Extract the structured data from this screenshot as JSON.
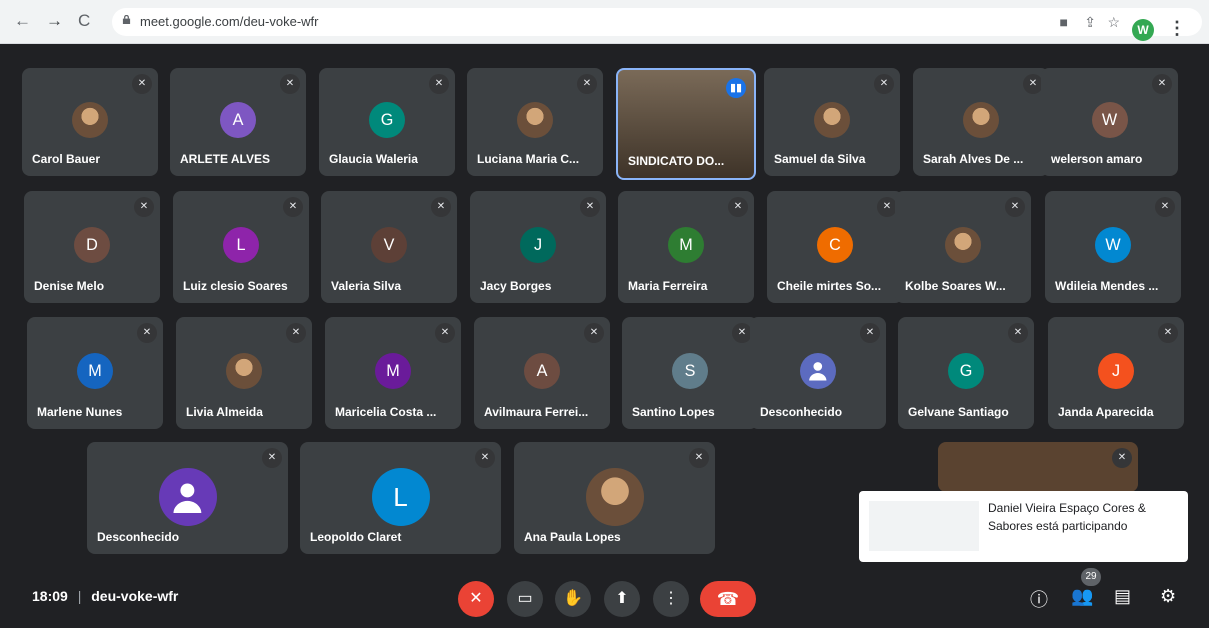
{
  "browser": {
    "url": "meet.google.com/deu-voke-wfr",
    "profile": "W"
  },
  "tiles": [
    {
      "name": "Carol Bauer",
      "initial": "",
      "color": "#3c4043",
      "photo": true
    },
    {
      "name": "ARLETE ALVES",
      "initial": "A",
      "color": "#7e57c2"
    },
    {
      "name": "Glaucia Waleria",
      "initial": "G",
      "color": "#00897b"
    },
    {
      "name": "Luciana Maria C...",
      "initial": "",
      "color": "#3c4043",
      "photo": true
    },
    {
      "name": "SINDICATO DO...",
      "initial": "",
      "color": "#3c4043",
      "video": true
    },
    {
      "name": "Samuel da Silva",
      "initial": "",
      "color": "#3c4043",
      "photo": true
    },
    {
      "name": "Sarah Alves De ...",
      "initial": "",
      "color": "#3c4043",
      "photo": true
    },
    {
      "name": "welerson amaro",
      "initial": "W",
      "color": "#795548"
    },
    {
      "name": "Denise Melo",
      "initial": "D",
      "color": "#6d4c41"
    },
    {
      "name": "Luiz clesio Soares",
      "initial": "L",
      "color": "#8e24aa"
    },
    {
      "name": "Valeria Silva",
      "initial": "V",
      "color": "#5d4037"
    },
    {
      "name": "Jacy Borges",
      "initial": "J",
      "color": "#00695c"
    },
    {
      "name": "Maria Ferreira",
      "initial": "M",
      "color": "#2e7d32"
    },
    {
      "name": "Cheile mirtes So...",
      "initial": "C",
      "color": "#ef6c00"
    },
    {
      "name": "Kolbe Soares W...",
      "initial": "",
      "color": "#3c4043",
      "photo": true
    },
    {
      "name": "Wdileia Mendes ...",
      "initial": "W",
      "color": "#0288d1"
    },
    {
      "name": "Marlene Nunes",
      "initial": "M",
      "color": "#1565c0"
    },
    {
      "name": "Livia Almeida",
      "initial": "",
      "color": "#3c4043",
      "photo": true
    },
    {
      "name": "Maricelia Costa ...",
      "initial": "M",
      "color": "#6a1b9a"
    },
    {
      "name": "Avilmaura Ferrei...",
      "initial": "A",
      "color": "#6d4c41"
    },
    {
      "name": "Santino Lopes",
      "initial": "S",
      "color": "#607d8b"
    },
    {
      "name": "Desconhecido",
      "initial": "",
      "color": "#5c6bc0",
      "person": true
    },
    {
      "name": "Gelvane Santiago",
      "initial": "G",
      "color": "#00897b"
    },
    {
      "name": "Janda Aparecida",
      "initial": "J",
      "color": "#f4511e"
    },
    {
      "name": "Desconhecido",
      "initial": "",
      "color": "#673ab7",
      "person": true
    },
    {
      "name": "Leopoldo Claret",
      "initial": "L",
      "color": "#0288d1"
    },
    {
      "name": "Ana Paula Lopes",
      "initial": "",
      "color": "#3c4043",
      "photo": true
    }
  ],
  "bottom": {
    "time": "18:09",
    "code": "deu-voke-wfr",
    "participants": "29"
  },
  "toast": {
    "text": "Daniel Vieira Espaço Cores & Sabores está participando"
  }
}
